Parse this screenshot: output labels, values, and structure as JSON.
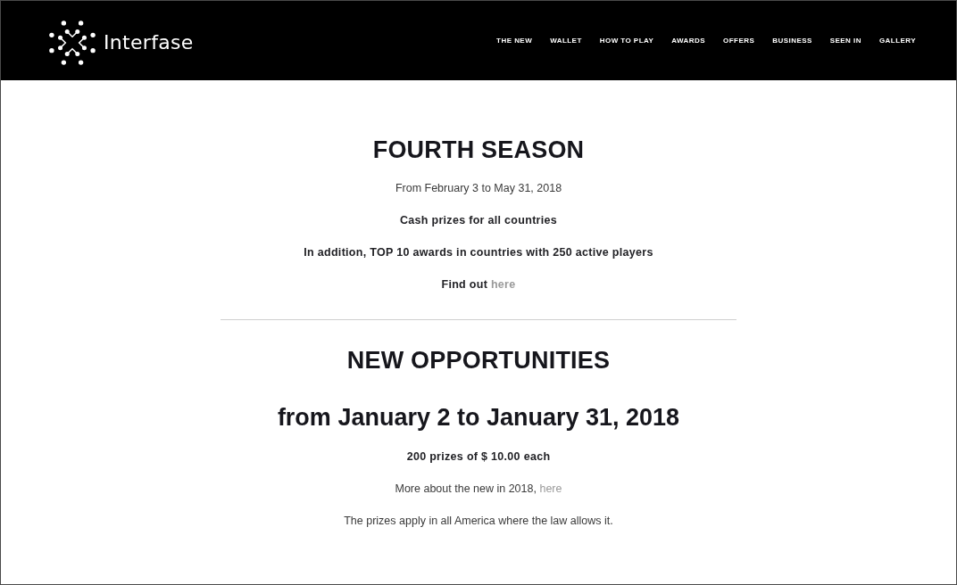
{
  "header": {
    "logo": {
      "text": "Interfase"
    },
    "nav": [
      {
        "label": "THE NEW"
      },
      {
        "label": "WALLET"
      },
      {
        "label": "HOW TO PLAY"
      },
      {
        "label": "AWARDS"
      },
      {
        "label": "OFFERS"
      },
      {
        "label": "BUSINESS"
      },
      {
        "label": "SEEN IN"
      },
      {
        "label": "GALLERY"
      }
    ]
  },
  "sections": [
    {
      "title": "FOURTH SEASON",
      "items": [
        {
          "kind": "light",
          "text": "From February 3 to May 31, 2018"
        },
        {
          "kind": "bold",
          "text": "Cash prizes for all countries"
        },
        {
          "kind": "bold",
          "text": "In addition, TOP 10 awards in countries with 250 active players"
        },
        {
          "kind": "bold",
          "text": "Find out",
          "link": "here"
        }
      ]
    },
    {
      "title": "NEW OPPORTUNITIES",
      "subtitle": "from January 2 to January 31, 2018",
      "items": [
        {
          "kind": "bold",
          "text": "200 prizes of $ 10.00 each"
        },
        {
          "kind": "light",
          "text": "More about the new in 2018,",
          "link": "here"
        },
        {
          "kind": "light",
          "text": "The prizes apply in all America where the law allows it."
        }
      ]
    }
  ]
}
